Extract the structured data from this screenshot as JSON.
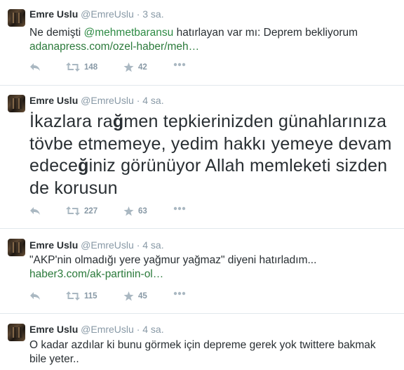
{
  "tweets": [
    {
      "name": "Emre Uslu",
      "handle": "@EmreUslu",
      "time": "· 3 sa.",
      "text_before": "Ne demişti ",
      "mention": "@mehmetbaransu",
      "text_after": " hatırlayan var mı: Deprem bekliyorum",
      "link": "adanapress.com/ozel-haber/meh…",
      "retweets": "148",
      "favorites": "42"
    },
    {
      "name": "Emre Uslu",
      "handle": "@EmreUslu",
      "time": "· 4 sa.",
      "line1_a": "İkazlara ra",
      "line1_b": "ğ",
      "line1_c": "men tepkierinizden günahlarınıza",
      "line2": "tövbe etmemeye, yedim hakkı yemeye devam",
      "line3_a": "edece",
      "line3_b": "ğ",
      "line3_c": "iniz görünüyor Allah memleketi sizden",
      "line4": "de korusun",
      "retweets": "227",
      "favorites": "63"
    },
    {
      "name": "Emre Uslu",
      "handle": "@EmreUslu",
      "time": "· 4 sa.",
      "text": "\"AKP'nin olmadığı yere yağmur yağmaz\" diyeni hatırladım...",
      "link": "haber3.com/ak-partinin-ol…",
      "retweets": "115",
      "favorites": "45"
    },
    {
      "name": "Emre Uslu",
      "handle": "@EmreUslu",
      "time": "· 4 sa.",
      "line1": "O kadar azdılar ki bunu görmek için depreme gerek yok twittere bakmak",
      "line2": "bile yeter.."
    }
  ],
  "icons": {
    "reply": "reply-icon",
    "retweet": "retweet-icon",
    "favorite": "star-icon",
    "more": "more-icon"
  },
  "colors": {
    "link": "#2b7a3b",
    "muted": "#8899a6",
    "text": "#292f33",
    "divider": "#e1e8ed"
  }
}
